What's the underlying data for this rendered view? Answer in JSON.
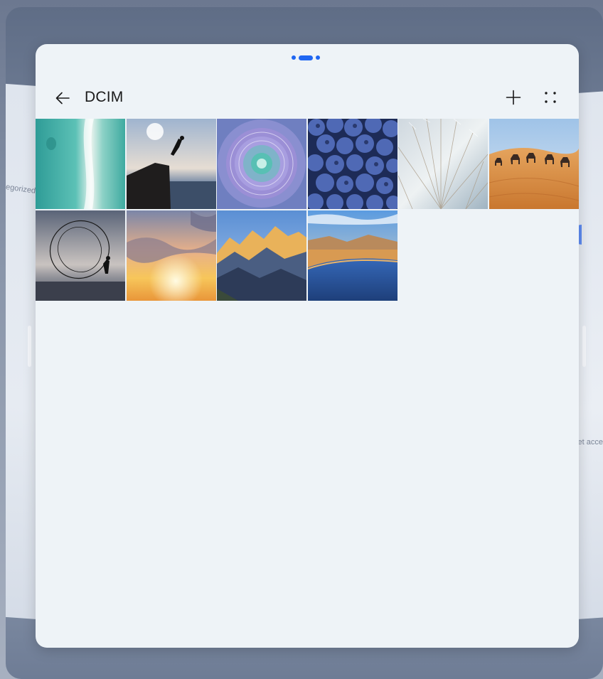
{
  "background": {
    "left_label": "egorized",
    "right_label": "et acce"
  },
  "window": {
    "title": "DCIM",
    "back_icon": "arrow-left-icon",
    "add_icon": "plus-icon",
    "more_icon": "more-dots-icon"
  },
  "photos": [
    {
      "subject": "aerial-turquoise-sea"
    },
    {
      "subject": "cliff-jumper-at-sunset"
    },
    {
      "subject": "purple-succulent"
    },
    {
      "subject": "blueberries"
    },
    {
      "subject": "dandelion-seeds"
    },
    {
      "subject": "desert-camel-caravan"
    },
    {
      "subject": "fisherman-casting-net"
    },
    {
      "subject": "sunset-clouds"
    },
    {
      "subject": "golden-mountain-peaks"
    },
    {
      "subject": "lake-in-desert"
    }
  ],
  "colors": {
    "accent": "#1f66f2",
    "window_bg": "#eef3f7",
    "title_text": "#1a1a1a"
  }
}
